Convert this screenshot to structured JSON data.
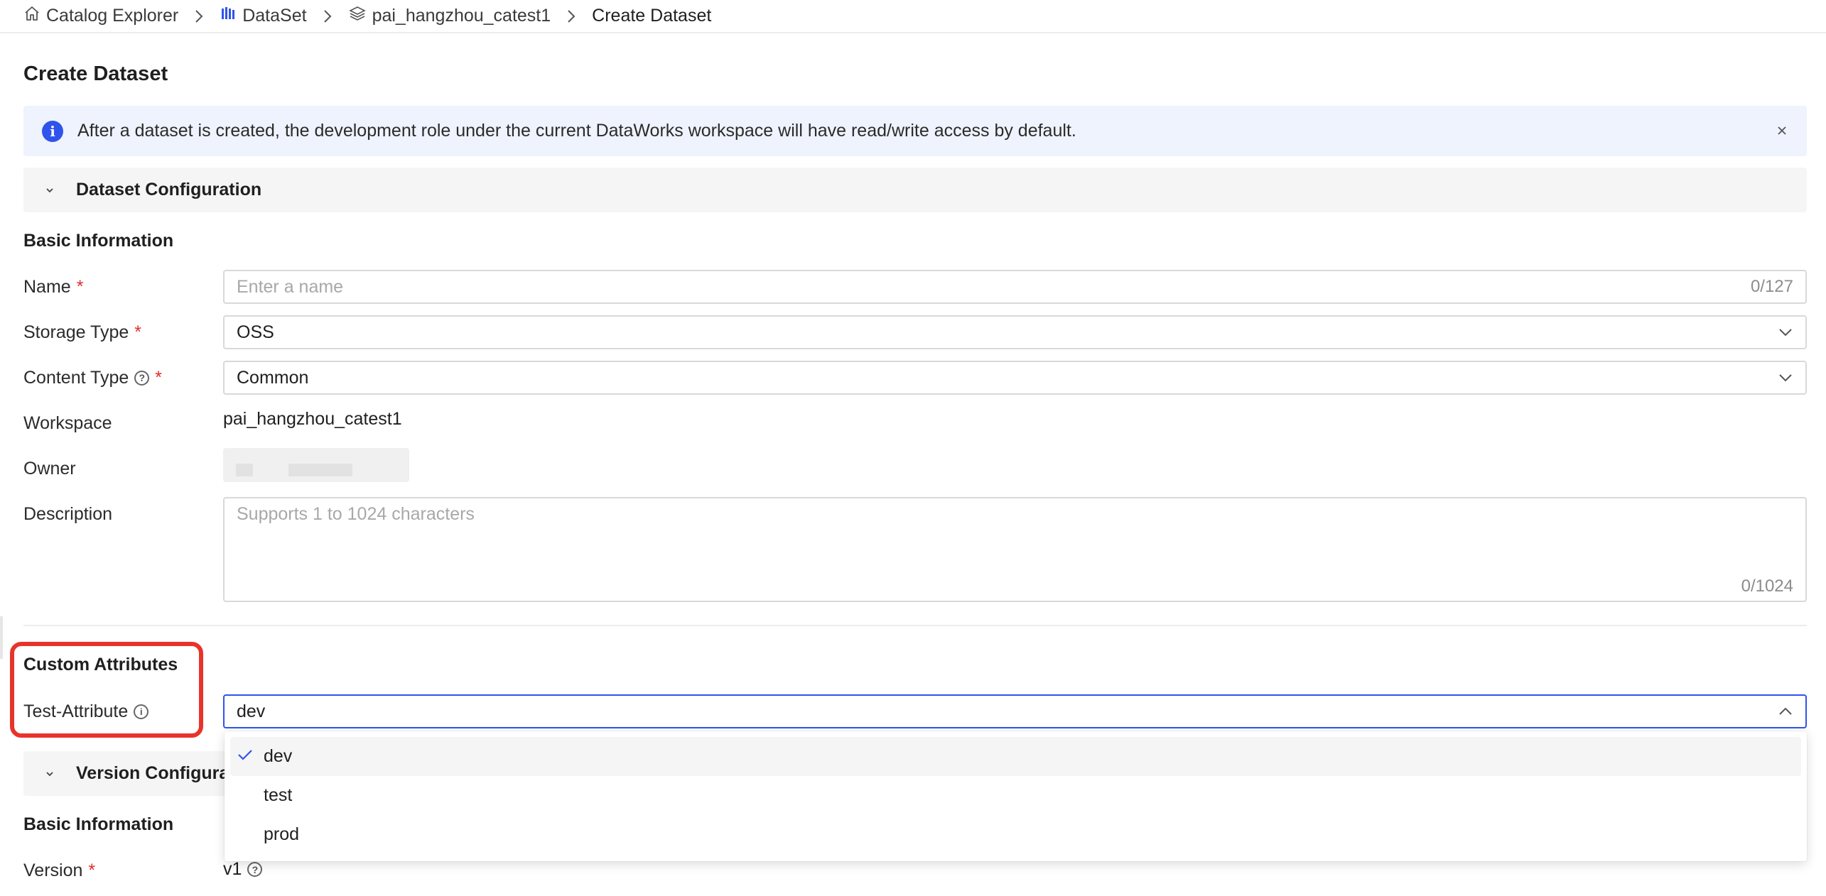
{
  "breadcrumb": {
    "items": [
      {
        "label": "Catalog Explorer",
        "icon": "home-icon"
      },
      {
        "label": "DataSet",
        "icon": "dataset-icon"
      },
      {
        "label": "pai_hangzhou_catest1",
        "icon": "layers-icon"
      },
      {
        "label": "Create Dataset",
        "icon": ""
      }
    ]
  },
  "page": {
    "title": "Create Dataset"
  },
  "notice": {
    "text": "After a dataset is created, the development role under the current DataWorks workspace will have read/write access by default."
  },
  "sections": {
    "dataset_config": "Dataset Configuration",
    "version_config": "Version Configurat"
  },
  "basic_info": {
    "title": "Basic Information",
    "name": {
      "label": "Name",
      "placeholder": "Enter a name",
      "counter": "0/127"
    },
    "storage_type": {
      "label": "Storage Type",
      "value": "OSS"
    },
    "content_type": {
      "label": "Content Type",
      "value": "Common"
    },
    "workspace": {
      "label": "Workspace",
      "value": "pai_hangzhou_catest1"
    },
    "owner": {
      "label": "Owner"
    },
    "description": {
      "label": "Description",
      "placeholder": "Supports 1 to 1024 characters",
      "counter": "0/1024"
    }
  },
  "custom_attributes": {
    "title": "Custom Attributes",
    "test_attribute": {
      "label": "Test-Attribute",
      "value": "dev"
    },
    "options": [
      "dev",
      "test",
      "prod"
    ],
    "selected": "dev"
  },
  "version_info": {
    "title": "Basic Information",
    "version": {
      "label": "Version",
      "value": "v1"
    }
  },
  "colors": {
    "accent": "#2f54eb",
    "required": "#e02d2d",
    "highlight": "#e8332b",
    "notice_bg": "#eef3fd"
  }
}
